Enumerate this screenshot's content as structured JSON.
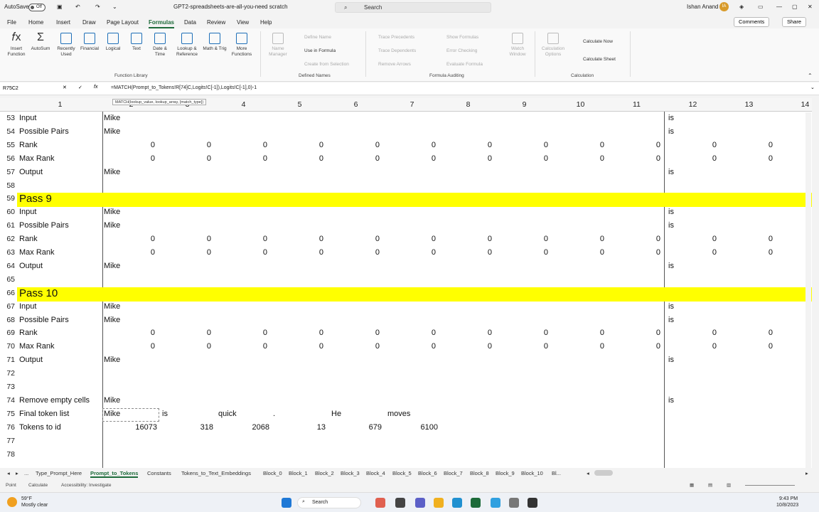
{
  "titlebar": {
    "autosave_label": "AutoSave",
    "autosave_state": "Off",
    "doc_title": "GPT2-spreadsheets-are-all-you-need scratch",
    "search_placeholder": "Search",
    "user_name": "Ishan Anand",
    "user_initials": "IA"
  },
  "menu": {
    "items": [
      "File",
      "Home",
      "Insert",
      "Draw",
      "Page Layout",
      "Formulas",
      "Data",
      "Review",
      "View",
      "Help"
    ],
    "active": "Formulas",
    "comments_label": "Comments",
    "share_label": "Share"
  },
  "ribbon": {
    "function_library": [
      "Insert Function",
      "AutoSum",
      "Recently Used",
      "Financial",
      "Logical",
      "Text",
      "Date & Time",
      "Lookup & Reference",
      "Math & Trig",
      "More Functions"
    ],
    "function_library_label": "Function Library",
    "name_manager": "Name Manager",
    "define_name": "Define Name",
    "use_in_formula": "Use in Formula",
    "create_from_selection": "Create from Selection",
    "defined_names_label": "Defined Names",
    "trace_precedents": "Trace Precedents",
    "trace_dependents": "Trace Dependents",
    "remove_arrows": "Remove Arrows",
    "show_formulas": "Show Formulas",
    "error_checking": "Error Checking",
    "evaluate_formula": "Evaluate Formula",
    "watch_window": "Watch Window",
    "formula_auditing_label": "Formula Auditing",
    "calculation_options": "Calculation Options",
    "calculate_now": "Calculate Now",
    "calculate_sheet": "Calculate Sheet",
    "calculation_label": "Calculation"
  },
  "formula_bar": {
    "name_box": "R75C2",
    "fx": "fx",
    "formula": "=MATCH(Prompt_to_Tokens!R[74]C,Logits!C[-1]),Logits!C[-1],0)-1",
    "tooltip": "MATCH(lookup_value, lookup_array, [match_type])"
  },
  "columns": [
    "1",
    "2",
    "3",
    "4",
    "5",
    "6",
    "7",
    "8",
    "9",
    "10",
    "11",
    "12",
    "13",
    "14"
  ],
  "rows": [
    {
      "n": "53",
      "label": "Input",
      "b": "Mike",
      "m": "is"
    },
    {
      "n": "54",
      "label": "Possible Pairs",
      "b": "Mike",
      "m": "is"
    },
    {
      "n": "55",
      "label": "Rank",
      "zeros": true
    },
    {
      "n": "56",
      "label": "Max Rank",
      "zeros": true
    },
    {
      "n": "57",
      "label": "Output",
      "b": "Mike",
      "m": "is"
    },
    {
      "n": "58",
      "label": ""
    },
    {
      "n": "59",
      "label": "Pass 9",
      "pass": true
    },
    {
      "n": "60",
      "label": "Input",
      "b": "Mike",
      "m": "is"
    },
    {
      "n": "61",
      "label": "Possible Pairs",
      "b": "Mike",
      "m": "is"
    },
    {
      "n": "62",
      "label": "Rank",
      "zeros": true
    },
    {
      "n": "63",
      "label": "Max Rank",
      "zeros": true
    },
    {
      "n": "64",
      "label": "Output",
      "b": "Mike",
      "m": "is"
    },
    {
      "n": "65",
      "label": ""
    },
    {
      "n": "66",
      "label": "Pass 10",
      "pass": true
    },
    {
      "n": "67",
      "label": "Input",
      "b": "Mike",
      "m": "is"
    },
    {
      "n": "68",
      "label": "Possible Pairs",
      "b": "Mike",
      "m": "is"
    },
    {
      "n": "69",
      "label": "Rank",
      "zeros": true
    },
    {
      "n": "70",
      "label": "Max Rank",
      "zeros": true
    },
    {
      "n": "71",
      "label": "Output",
      "b": "Mike",
      "m": "is"
    },
    {
      "n": "72",
      "label": ""
    },
    {
      "n": "73",
      "label": ""
    },
    {
      "n": "74",
      "label": "Remove empty cells",
      "b": "Mike",
      "m": "is"
    },
    {
      "n": "75",
      "label": "Final token list",
      "tokens": [
        "Mike",
        "is",
        "quick",
        ".",
        "He",
        "moves"
      ]
    },
    {
      "n": "76",
      "label": "Tokens to id",
      "ids": [
        "16073",
        "318",
        "2068",
        "13",
        "679",
        "6100"
      ]
    },
    {
      "n": "77",
      "label": ""
    },
    {
      "n": "78",
      "label": ""
    }
  ],
  "zero_value": "0",
  "sheet_tabs": [
    "Type_Prompt_Here",
    "Prompt_to_Tokens",
    "Constants",
    "Tokens_to_Text_Embeddings",
    "Block_0",
    "Block_1",
    "Block_2",
    "Block_3",
    "Block_4",
    "Block_5",
    "Block_6",
    "Block_7",
    "Block_8",
    "Block_9",
    "Block_10",
    "Bl..."
  ],
  "active_sheet": "Prompt_to_Tokens",
  "status": {
    "mode": "Point",
    "calc": "Calculate",
    "accessibility": "Accessibility: Investigate"
  },
  "taskbar": {
    "weather_temp": "59°F",
    "weather_desc": "Mostly clear",
    "search": "Search",
    "time": "9:43 PM",
    "date": "10/8/2023"
  },
  "colors": {
    "accent": "#1d6b3a",
    "highlight": "#ffff00"
  }
}
